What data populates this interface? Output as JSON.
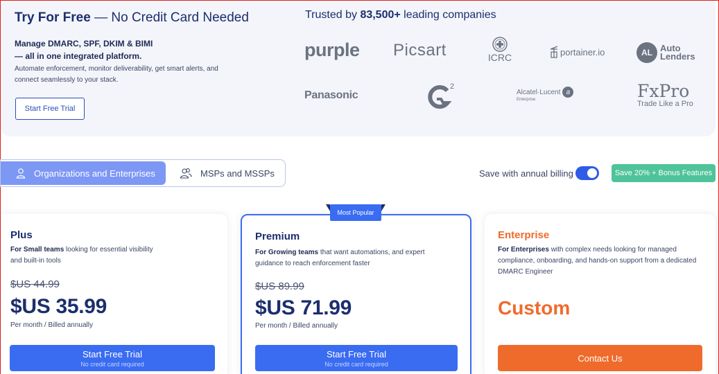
{
  "hero": {
    "title_bold": "Try For Free",
    "title_rest": " — No Credit Card Needed",
    "sub1": "Manage DMARC, SPF, DKIM & BIMI",
    "sub2": "— all in one integrated platform.",
    "desc": "Automate enforcement, monitor deliverability, get smart alerts, and connect seamlessly to your stack.",
    "cta_label": "Start Free Trial"
  },
  "trusted": {
    "prefix": "Trusted by ",
    "count": "83,500+",
    "suffix": " leading companies",
    "logos": {
      "purple": "purple",
      "picsart": "Picsart",
      "icrc": "ICRC",
      "portainer": "portainer.io",
      "auto_top": "Auto",
      "auto_bottom": "Lenders",
      "auto_badge": "AL",
      "panasonic": "Panasonic",
      "g2": "G2",
      "alcatel": "Alcatel·Lucent",
      "alcatel_sub": "Enterprise",
      "fxpro": "FxPro",
      "fxpro_tag": "Trade Like a Pro"
    }
  },
  "segments": {
    "active": "Organizations and Enterprises",
    "inactive": "MSPs and MSSPs"
  },
  "billing": {
    "label": "Save with annual billing",
    "toggle_on": true,
    "badge": "Save 20% + Bonus Features"
  },
  "popular_badge": "Most Popular",
  "plans": [
    {
      "name": "Plus",
      "desc_bold": "For Small teams",
      "desc_rest": " looking for essential visibility and built-in tools",
      "old_price": "$US 44.99",
      "price": "$US 35.99",
      "period": "Per month / Billed annually",
      "cta": "Start Free Trial",
      "cta_sub": "No credit card required"
    },
    {
      "name": "Premium",
      "desc_bold": "For Growing teams",
      "desc_rest": " that want automations, and expert guidance to reach enforcement faster",
      "old_price": "$US 89.99",
      "price": "$US 71.99",
      "period": "Per month / Billed annually",
      "cta": "Start Free Trial",
      "cta_sub": "No credit card required"
    },
    {
      "name": "Enterprise",
      "desc_bold": "For Enterprises",
      "desc_rest": " with complex needs looking for managed compliance, onboarding, and hands-on support from a dedicated DMARC Engineer",
      "price": "Custom",
      "cta": "Contact Us"
    }
  ],
  "colors": {
    "primary": "#3a6cf2",
    "navy": "#1b2e6e",
    "orange": "#ef6b2c",
    "green_badge": "#4fc39a",
    "tab_active": "#7d97f5"
  }
}
